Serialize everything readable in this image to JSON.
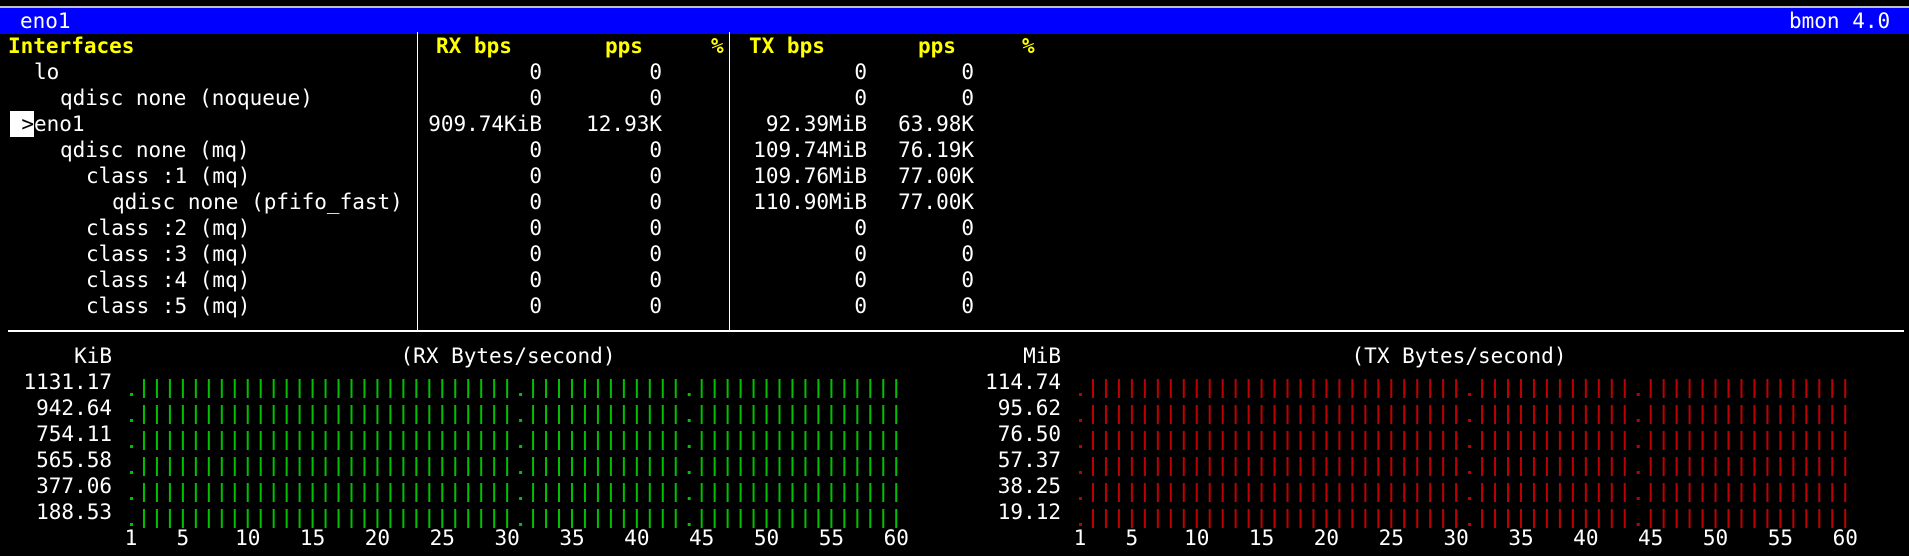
{
  "titlebar": {
    "left": "eno1",
    "right": "bmon 4.0"
  },
  "headers": {
    "interfaces": "Interfaces",
    "rx_bps": "RX bps",
    "rx_pps": "pps",
    "rx_pct": "%",
    "tx_bps": "TX bps",
    "tx_pps": "pps",
    "tx_pct": "%"
  },
  "rows": [
    {
      "name": "lo",
      "indent": 1,
      "rx_bps": "0",
      "rx_pps": "0",
      "tx_bps": "0",
      "tx_pps": "0",
      "selected": false
    },
    {
      "name": "qdisc none (noqueue)",
      "indent": 2,
      "rx_bps": "0",
      "rx_pps": "0",
      "tx_bps": "0",
      "tx_pps": "0",
      "selected": false
    },
    {
      "name": "eno1",
      "indent": 1,
      "rx_bps": "909.74KiB",
      "rx_pps": "12.93K",
      "tx_bps": "92.39MiB",
      "tx_pps": "63.98K",
      "selected": true
    },
    {
      "name": "qdisc none (mq)",
      "indent": 2,
      "rx_bps": "0",
      "rx_pps": "0",
      "tx_bps": "109.74MiB",
      "tx_pps": "76.19K",
      "selected": false
    },
    {
      "name": "class :1 (mq)",
      "indent": 3,
      "rx_bps": "0",
      "rx_pps": "0",
      "tx_bps": "109.76MiB",
      "tx_pps": "77.00K",
      "selected": false
    },
    {
      "name": "qdisc none (pfifo_fast)",
      "indent": 4,
      "rx_bps": "0",
      "rx_pps": "0",
      "tx_bps": "110.90MiB",
      "tx_pps": "77.00K",
      "selected": false
    },
    {
      "name": "class :2 (mq)",
      "indent": 3,
      "rx_bps": "0",
      "rx_pps": "0",
      "tx_bps": "0",
      "tx_pps": "0",
      "selected": false
    },
    {
      "name": "class :3 (mq)",
      "indent": 3,
      "rx_bps": "0",
      "rx_pps": "0",
      "tx_bps": "0",
      "tx_pps": "0",
      "selected": false
    },
    {
      "name": "class :4 (mq)",
      "indent": 3,
      "rx_bps": "0",
      "rx_pps": "0",
      "tx_bps": "0",
      "tx_pps": "0",
      "selected": false
    },
    {
      "name": "class :5 (mq)",
      "indent": 3,
      "rx_bps": "0",
      "rx_pps": "0",
      "tx_bps": "0",
      "tx_pps": "0",
      "selected": false
    }
  ],
  "cursor_glyph": ">",
  "colors": {
    "title_bg": "#0000ff",
    "header": "#ffff00",
    "rx_bar": "#00c000",
    "tx_bar": "#c00000"
  },
  "rx_graph": {
    "unit": "KiB",
    "title": "(RX Bytes/second)",
    "y_labels": [
      "1131.17",
      "942.64",
      "754.11",
      "565.58",
      "377.06",
      "188.53"
    ],
    "x_labels": [
      "1",
      "5",
      "10",
      "15",
      "20",
      "25",
      "30",
      "35",
      "40",
      "45",
      "50",
      "55",
      "60"
    ],
    "dot_columns": [
      1,
      31,
      44
    ]
  },
  "tx_graph": {
    "unit": "MiB",
    "title": "(TX Bytes/second)",
    "y_labels": [
      "114.74",
      "95.62",
      "76.50",
      "57.37",
      "38.25",
      "19.12"
    ],
    "x_labels": [
      "1",
      "5",
      "10",
      "15",
      "20",
      "25",
      "30",
      "35",
      "40",
      "45",
      "50",
      "55",
      "60"
    ],
    "dot_columns": [
      1,
      31,
      44
    ]
  }
}
